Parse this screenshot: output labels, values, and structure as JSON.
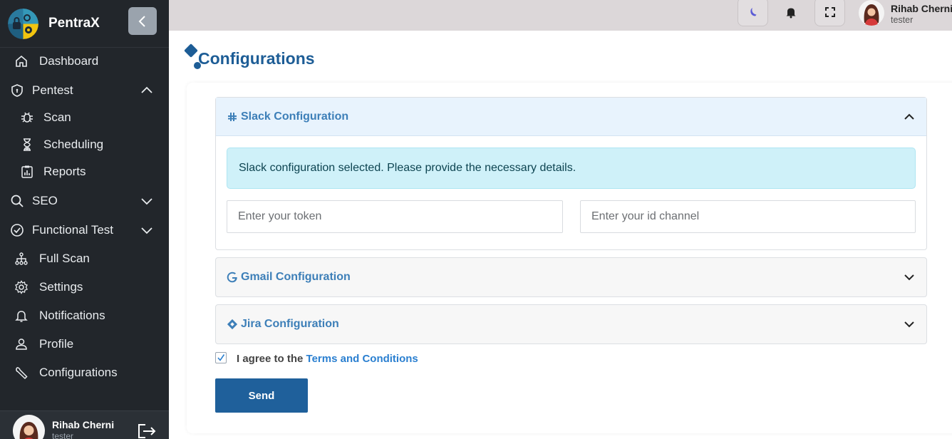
{
  "app": {
    "name": "PentraX",
    "colors": {
      "sidebar": "#22262b",
      "accent": "#1d5d96",
      "alert_bg": "#cff1f9",
      "send_button": "#1f609b"
    }
  },
  "sidebar": {
    "items": [
      {
        "label": "Dashboard",
        "icon": "home-icon"
      },
      {
        "label": "Pentest",
        "icon": "shield-icon",
        "expanded": true
      },
      {
        "label": "Scan",
        "icon": "bug-icon",
        "sub": true
      },
      {
        "label": "Scheduling",
        "icon": "hourglass-icon",
        "sub": true
      },
      {
        "label": "Reports",
        "icon": "report-icon",
        "sub": true
      },
      {
        "label": "SEO",
        "icon": "search-icon",
        "expanded": false
      },
      {
        "label": "Functional Test",
        "icon": "check-circle-icon",
        "expanded": false
      },
      {
        "label": "Full Scan",
        "icon": "sitemap-icon"
      },
      {
        "label": "Settings",
        "icon": "gear-icon"
      },
      {
        "label": "Notifications",
        "icon": "bell-icon"
      },
      {
        "label": "Profile",
        "icon": "user-icon"
      },
      {
        "label": "Configurations",
        "icon": "wrench-icon"
      }
    ],
    "user": {
      "name": "Rihab Cherni",
      "role": "tester"
    }
  },
  "topbar": {
    "user": {
      "name": "Rihab Cherni",
      "role": "tester"
    },
    "icons": [
      "moon-icon",
      "bell-icon",
      "fullscreen-icon"
    ]
  },
  "main": {
    "title": "Configurations",
    "accordions": [
      {
        "title": "Slack Configuration",
        "icon": "slack-icon",
        "open": true
      },
      {
        "title": "Gmail Configuration",
        "icon": "google-icon",
        "open": false
      },
      {
        "title": "Jira Configuration",
        "icon": "jira-icon",
        "open": false
      }
    ],
    "slack": {
      "alert": "Slack configuration selected. Please provide the necessary details.",
      "token_placeholder": "Enter your token",
      "channel_placeholder": "Enter your id channel"
    },
    "agree": {
      "prefix": "I agree to the ",
      "link": "Terms and Conditions",
      "checked": true
    },
    "send_label": "Send"
  }
}
